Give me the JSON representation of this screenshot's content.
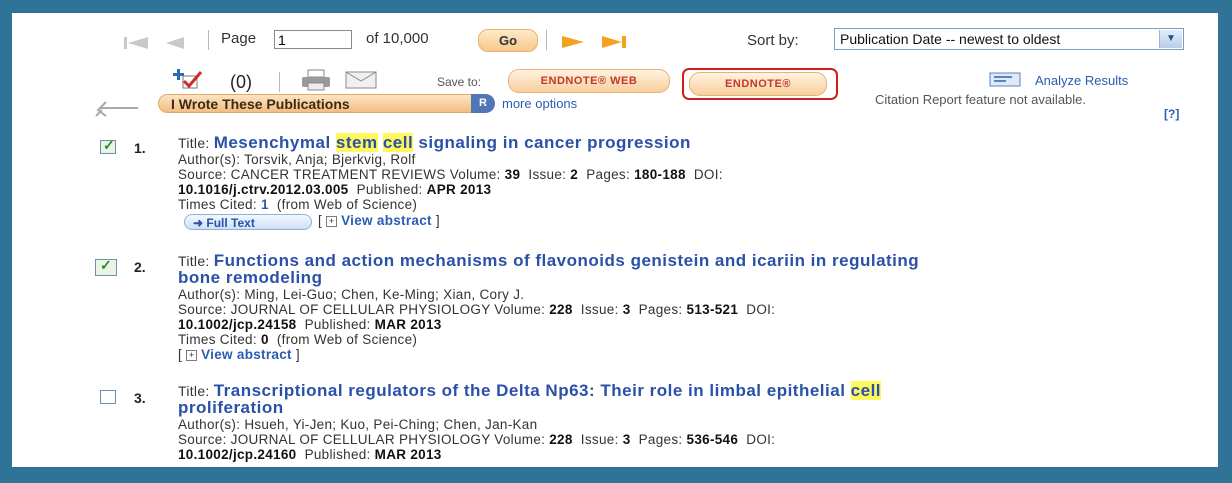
{
  "nav": {
    "page_label": "Page",
    "page_value": "1",
    "of_label": "of 10,000",
    "go_label": "Go",
    "sort_label": "Sort by:",
    "sort_value": "Publication Date -- newest to oldest"
  },
  "toolbar": {
    "marked_count": "(0)",
    "save_to_label": "Save to:",
    "endnote_web_label": "ENDNOTE® WEB",
    "endnote_label": "ENDNOTE®",
    "analyze_label": "Analyze Results",
    "citation_note": "Citation Report feature not available.",
    "help_label": "[?]",
    "iwrote_label": "I Wrote These Publications",
    "iwrote_badge": "R",
    "more_options": "more options"
  },
  "records": [
    {
      "number": "1.",
      "checked": true,
      "title_label": "Title:",
      "title_parts": [
        {
          "text": "Mesenchymal ",
          "hl": false
        },
        {
          "text": "stem",
          "hl": true
        },
        {
          "text": " ",
          "hl": false
        },
        {
          "text": "cell",
          "hl": true
        },
        {
          "text": " signaling in cancer progression",
          "hl": false
        }
      ],
      "title_line2": "",
      "authors": "Author(s): Torsvik, Anja; Bjerkvig, Rolf",
      "source_prefix": "Source: CANCER TREATMENT REVIEWS  Volume:",
      "volume": "39",
      "issue_label": "Issue:",
      "issue": "2",
      "pages_label": "Pages:",
      "pages": "180-188",
      "doi_label": "DOI:",
      "doi": "10.1016/j.ctrv.2012.03.005",
      "published_label": "Published:",
      "published": "APR 2013",
      "times_cited_label": "Times Cited:",
      "times_cited": "1",
      "times_cited_suffix": "(from Web of Science)",
      "full_text": "Full Text",
      "view_abstract": "View abstract"
    },
    {
      "number": "2.",
      "checked": true,
      "title_label": "Title:",
      "title_parts": [
        {
          "text": "Functions and action mechanisms of flavonoids genistein and icariin in regulating",
          "hl": false
        }
      ],
      "title_line2": "bone remodeling",
      "authors": "Author(s): Ming, Lei-Guo; Chen, Ke-Ming; Xian, Cory J.",
      "source_prefix": "Source: JOURNAL OF CELLULAR PHYSIOLOGY  Volume:",
      "volume": "228",
      "issue_label": "Issue:",
      "issue": "3",
      "pages_label": "Pages:",
      "pages": "513-521",
      "doi_label": "DOI:",
      "doi": "10.1002/jcp.24158",
      "published_label": "Published:",
      "published": "MAR 2013",
      "times_cited_label": "Times Cited:",
      "times_cited": "0",
      "times_cited_suffix": "(from Web of Science)",
      "view_abstract": "View abstract"
    },
    {
      "number": "3.",
      "checked": false,
      "title_label": "Title:",
      "title_parts": [
        {
          "text": "Transcriptional regulators of the Delta Np63: Their role in limbal epithelial ",
          "hl": false
        },
        {
          "text": "cell",
          "hl": true
        }
      ],
      "title_line2": "proliferation",
      "authors": "Author(s): Hsueh, Yi-Jen; Kuo, Pei-Ching; Chen, Jan-Kan",
      "source_prefix": "Source: JOURNAL OF CELLULAR PHYSIOLOGY  Volume:",
      "volume": "228",
      "issue_label": "Issue:",
      "issue": "3",
      "pages_label": "Pages:",
      "pages": "536-546",
      "doi_label": "DOI:",
      "doi": "10.1002/jcp.24160",
      "published_label": "Published:",
      "published": "MAR 2013"
    }
  ],
  "colors": {
    "frame": "#2f7496",
    "link": "#2a50a8",
    "highlight": "#fff85c",
    "endnote_box": "#cf1e1e"
  }
}
